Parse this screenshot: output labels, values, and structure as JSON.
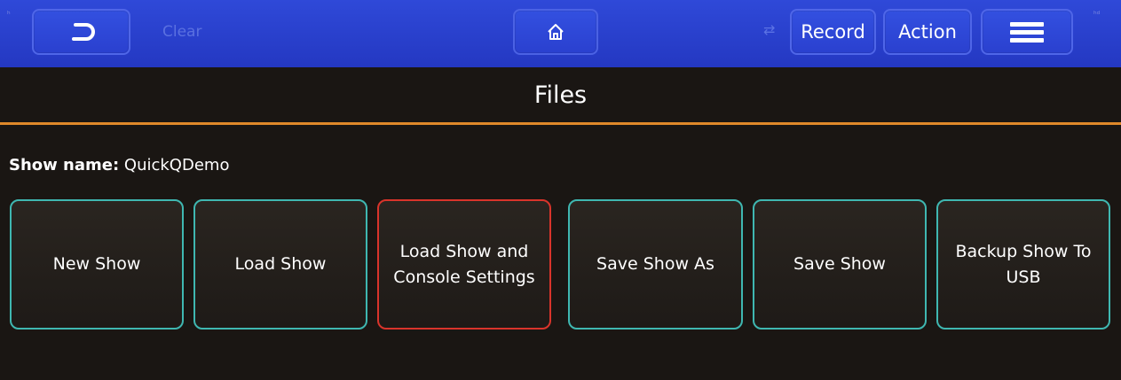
{
  "toolbar": {
    "back_icon": "undo-arrow-icon",
    "clear_label": "Clear",
    "home_icon": "home-icon",
    "record_label": "Record",
    "action_label": "Action",
    "menu_icon": "hamburger-menu-icon"
  },
  "page": {
    "title": "Files"
  },
  "show": {
    "label": "Show name:",
    "value": "QuickQDemo"
  },
  "buttons": [
    {
      "label": "New Show"
    },
    {
      "label": "Load Show"
    },
    {
      "label": "Load Show and Console Settings"
    },
    {
      "label": "Save Show As"
    },
    {
      "label": "Save Show"
    },
    {
      "label": "Backup Show To USB"
    }
  ],
  "colors": {
    "toolbar": "#2438c2",
    "accent": "#e0892a",
    "button_border": "#3fb7b1",
    "selected_border": "#d9342b",
    "background": "#1a1613"
  }
}
